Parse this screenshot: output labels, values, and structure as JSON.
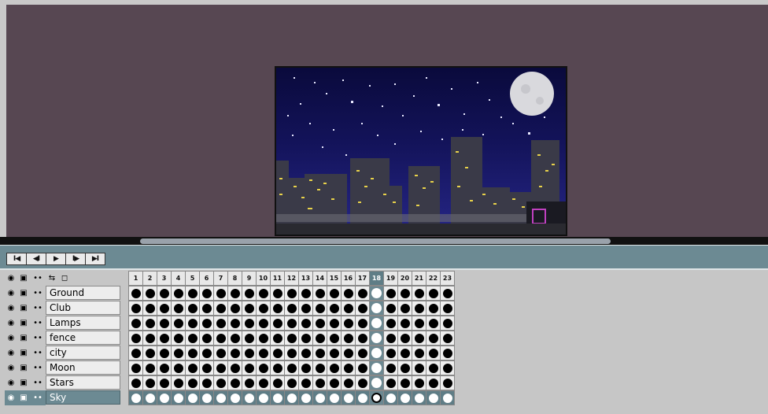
{
  "colors": {
    "stage_bg": "#574752",
    "timeline_bg": "#c6c6c6",
    "toolbar_bg": "#6c8a93",
    "selected_row": "#6c8a93",
    "sky_top": "#0a0a3c",
    "sky_bottom": "#262686",
    "window_light": "#e8d24a"
  },
  "playback": {
    "first_frame_label": "I◀",
    "prev_frame_label": "◀I",
    "play_label": "▶",
    "next_frame_label": "I▶",
    "last_frame_label": "▶I"
  },
  "header_icons": [
    "eye-icon",
    "lock-icon",
    "onion-dots-icon",
    "link-icon",
    "new-layer-icon"
  ],
  "frames": [
    "1",
    "2",
    "3",
    "4",
    "5",
    "6",
    "7",
    "8",
    "9",
    "10",
    "11",
    "12",
    "13",
    "14",
    "15",
    "16",
    "17",
    "18",
    "19",
    "20",
    "21",
    "22",
    "23"
  ],
  "current_frame": "18",
  "layers": [
    {
      "name": "Ground"
    },
    {
      "name": "Club"
    },
    {
      "name": "Lamps"
    },
    {
      "name": "fence"
    },
    {
      "name": "city"
    },
    {
      "name": "Moon"
    },
    {
      "name": "Stars"
    },
    {
      "name": "Sky"
    }
  ],
  "selected_layer": "Sky"
}
